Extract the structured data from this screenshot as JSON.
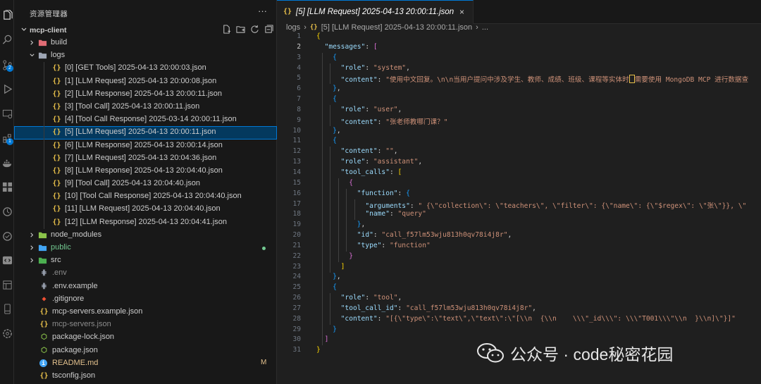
{
  "sidebar": {
    "title": "资源管理器",
    "more": "···",
    "section": "mcp-client"
  },
  "tree": [
    {
      "name": "build",
      "type": "folder",
      "expanded": false,
      "depth": 1,
      "icon": "build-folder-icon",
      "color": "#e06c75"
    },
    {
      "name": "logs",
      "type": "folder",
      "expanded": true,
      "depth": 1,
      "icon": "logs-folder-icon",
      "color": "#9da5b4"
    },
    {
      "name": "[0] [GET Tools] 2025-04-13 20:00:03.json",
      "type": "json",
      "depth": 2
    },
    {
      "name": "[1] [LLM Request] 2025-04-13 20:00:08.json",
      "type": "json",
      "depth": 2
    },
    {
      "name": "[2] [LLM Response] 2025-04-13 20:00:11.json",
      "type": "json",
      "depth": 2
    },
    {
      "name": "[3] [Tool Call] 2025-04-13 20:00:11.json",
      "type": "json",
      "depth": 2
    },
    {
      "name": "[4] [Tool Call Response] 2025-03-14 20:00:11.json",
      "type": "json",
      "depth": 2
    },
    {
      "name": "[5] [LLM Request] 2025-04-13 20:00:11.json",
      "type": "json",
      "depth": 2,
      "selected": true
    },
    {
      "name": "[6] [LLM Response] 2025-04-13 20:00:14.json",
      "type": "json",
      "depth": 2
    },
    {
      "name": "[7] [LLM Request] 2025-04-13 20:04:36.json",
      "type": "json",
      "depth": 2
    },
    {
      "name": "[8] [LLM Response] 2025-04-13 20:04:40.json",
      "type": "json",
      "depth": 2
    },
    {
      "name": "[9] [Tool Call] 2025-04-13 20:04:40.json",
      "type": "json",
      "depth": 2
    },
    {
      "name": "[10] [Tool Call Response] 2025-04-13 20:04:40.json",
      "type": "json",
      "depth": 2
    },
    {
      "name": "[11] [LLM Request] 2025-04-13 20:04:40.json",
      "type": "json",
      "depth": 2
    },
    {
      "name": "[12] [LLM Response] 2025-04-13 20:04:41.json",
      "type": "json",
      "depth": 2
    },
    {
      "name": "node_modules",
      "type": "folder",
      "expanded": false,
      "depth": 1,
      "icon": "node-folder-icon",
      "color": "#8bc34a"
    },
    {
      "name": "public",
      "type": "folder",
      "expanded": false,
      "depth": 1,
      "icon": "public-folder-icon",
      "color": "#42a5f5",
      "git": true,
      "dot": true
    },
    {
      "name": "src",
      "type": "folder",
      "expanded": false,
      "depth": 1,
      "icon": "src-folder-icon",
      "color": "#4caf50"
    },
    {
      "name": ".env",
      "type": "env",
      "depth": 1,
      "dim": true
    },
    {
      "name": ".env.example",
      "type": "env",
      "depth": 1
    },
    {
      "name": ".gitignore",
      "type": "git",
      "depth": 1
    },
    {
      "name": "mcp-servers.example.json",
      "type": "json",
      "depth": 1
    },
    {
      "name": "mcp-servers.json",
      "type": "json",
      "depth": 1,
      "dim": true
    },
    {
      "name": "package-lock.json",
      "type": "npm",
      "depth": 1
    },
    {
      "name": "package.json",
      "type": "npm",
      "depth": 1
    },
    {
      "name": "README.md",
      "type": "info",
      "depth": 1,
      "mod": true,
      "status": "M"
    },
    {
      "name": "tsconfig.json",
      "type": "ts",
      "depth": 1
    }
  ],
  "editor": {
    "tab_label": "[5] [LLM Request] 2025-04-13 20:00:11.json",
    "tab_close": "×",
    "breadcrumb": {
      "folder": "logs",
      "file": "[5] [LLM Request] 2025-04-13 20:00:11.json",
      "more": "..."
    },
    "active_line": 2,
    "lines": [
      [
        [
          "b1",
          "{"
        ]
      ],
      [
        [
          "p",
          "  "
        ],
        [
          "k",
          "\"messages\""
        ],
        [
          "p",
          ": "
        ],
        [
          "b2",
          "["
        ]
      ],
      [
        [
          "p",
          "    "
        ],
        [
          "b3",
          "{"
        ]
      ],
      [
        [
          "p",
          "      "
        ],
        [
          "k",
          "\"role\""
        ],
        [
          "p",
          ": "
        ],
        [
          "s",
          "\"system\""
        ],
        [
          "p",
          ","
        ]
      ],
      [
        [
          "p",
          "      "
        ],
        [
          "k",
          "\"content\""
        ],
        [
          "p",
          ": "
        ],
        [
          "s",
          "\"使用中文回复。\\n\\n当用户提问中涉及学生、教师、成绩、班级、课程等实体时"
        ],
        [
          "cur",
          ""
        ],
        [
          "s",
          "需要使用 MongoDB MCP 进行数据查"
        ]
      ],
      [
        [
          "p",
          "    "
        ],
        [
          "b3",
          "}"
        ],
        [
          "p",
          ","
        ]
      ],
      [
        [
          "p",
          "    "
        ],
        [
          "b3",
          "{"
        ]
      ],
      [
        [
          "p",
          "      "
        ],
        [
          "k",
          "\"role\""
        ],
        [
          "p",
          ": "
        ],
        [
          "s",
          "\"user\""
        ],
        [
          "p",
          ","
        ]
      ],
      [
        [
          "p",
          "      "
        ],
        [
          "k",
          "\"content\""
        ],
        [
          "p",
          ": "
        ],
        [
          "s",
          "\"张老师教哪门课？\""
        ]
      ],
      [
        [
          "p",
          "    "
        ],
        [
          "b3",
          "}"
        ],
        [
          "p",
          ","
        ]
      ],
      [
        [
          "p",
          "    "
        ],
        [
          "b3",
          "{"
        ]
      ],
      [
        [
          "p",
          "      "
        ],
        [
          "k",
          "\"content\""
        ],
        [
          "p",
          ": "
        ],
        [
          "s",
          "\"\""
        ],
        [
          "p",
          ","
        ]
      ],
      [
        [
          "p",
          "      "
        ],
        [
          "k",
          "\"role\""
        ],
        [
          "p",
          ": "
        ],
        [
          "s",
          "\"assistant\""
        ],
        [
          "p",
          ","
        ]
      ],
      [
        [
          "p",
          "      "
        ],
        [
          "k",
          "\"tool_calls\""
        ],
        [
          "p",
          ": "
        ],
        [
          "b1",
          "["
        ]
      ],
      [
        [
          "p",
          "        "
        ],
        [
          "b2",
          "{"
        ]
      ],
      [
        [
          "p",
          "          "
        ],
        [
          "k",
          "\"function\""
        ],
        [
          "p",
          ": "
        ],
        [
          "b3",
          "{"
        ]
      ],
      [
        [
          "p",
          "            "
        ],
        [
          "k",
          "\"arguments\""
        ],
        [
          "p",
          ": "
        ],
        [
          "s",
          "\" {\\\"collection\\\": \\\"teachers\\\", \\\"filter\\\": {\\\"name\\\": {\\\"$regex\\\": \\\"张\\\"}}, \\\""
        ]
      ],
      [
        [
          "p",
          "            "
        ],
        [
          "k",
          "\"name\""
        ],
        [
          "p",
          ": "
        ],
        [
          "s",
          "\"query\""
        ]
      ],
      [
        [
          "p",
          "          "
        ],
        [
          "b3",
          "}"
        ],
        [
          "p",
          ","
        ]
      ],
      [
        [
          "p",
          "          "
        ],
        [
          "k",
          "\"id\""
        ],
        [
          "p",
          ": "
        ],
        [
          "s",
          "\"call_f57lm53wju813h0qv78i4j8r\""
        ],
        [
          "p",
          ","
        ]
      ],
      [
        [
          "p",
          "          "
        ],
        [
          "k",
          "\"type\""
        ],
        [
          "p",
          ": "
        ],
        [
          "s",
          "\"function\""
        ]
      ],
      [
        [
          "p",
          "        "
        ],
        [
          "b2",
          "}"
        ]
      ],
      [
        [
          "p",
          "      "
        ],
        [
          "b1",
          "]"
        ]
      ],
      [
        [
          "p",
          "    "
        ],
        [
          "b3",
          "}"
        ],
        [
          "p",
          ","
        ]
      ],
      [
        [
          "p",
          "    "
        ],
        [
          "b3",
          "{"
        ]
      ],
      [
        [
          "p",
          "      "
        ],
        [
          "k",
          "\"role\""
        ],
        [
          "p",
          ": "
        ],
        [
          "s",
          "\"tool\""
        ],
        [
          "p",
          ","
        ]
      ],
      [
        [
          "p",
          "      "
        ],
        [
          "k",
          "\"tool_call_id\""
        ],
        [
          "p",
          ": "
        ],
        [
          "s",
          "\"call_f57lm53wju813h0qv78i4j8r\""
        ],
        [
          "p",
          ","
        ]
      ],
      [
        [
          "p",
          "      "
        ],
        [
          "k",
          "\"content\""
        ],
        [
          "p",
          ": "
        ],
        [
          "s",
          "\"[{\\\"type\\\":\\\"text\\\",\\\"text\\\":\\\"[\\\\n  {\\\\n    \\\\\\\"_id\\\\\\\": \\\\\\\"T001\\\\\\\"\\\\n  }\\\\n]\\\"}]\""
        ]
      ],
      [
        [
          "p",
          "    "
        ],
        [
          "b3",
          "}"
        ]
      ],
      [
        [
          "p",
          "  "
        ],
        [
          "b2",
          "]"
        ]
      ],
      [
        [
          "b1",
          "}"
        ]
      ]
    ]
  },
  "watermark": "公众号 · code秘密花园",
  "colors": {
    "accent": "#0078d4",
    "json_icon": "#e8c04a",
    "git_added": "#73c991",
    "modified": "#e2c08d"
  }
}
